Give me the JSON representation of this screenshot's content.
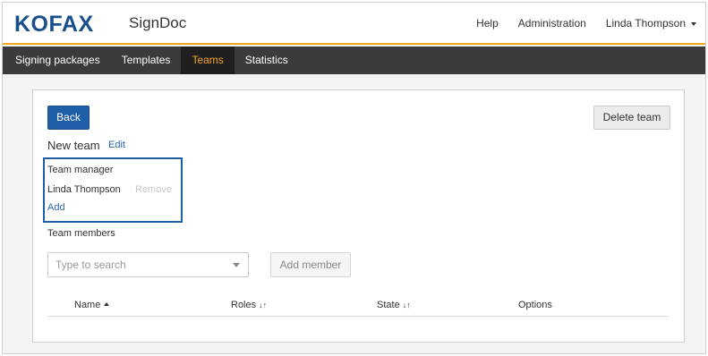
{
  "header": {
    "logo": "KOFAX",
    "product": "SignDoc",
    "links": [
      "Help",
      "Administration"
    ],
    "user": "Linda Thompson"
  },
  "nav": {
    "items": [
      "Signing packages",
      "Templates",
      "Teams",
      "Statistics"
    ],
    "active": "Teams"
  },
  "team": {
    "back_label": "Back",
    "delete_label": "Delete team",
    "name": "New team",
    "edit_label": "Edit",
    "manager_label": "Team manager",
    "manager_name": "Linda Thompson",
    "remove_label": "Remove",
    "add_label": "Add",
    "members_label": "Team members",
    "search_placeholder": "Type to search",
    "add_member_label": "Add member"
  },
  "table": {
    "columns": [
      "Name",
      "Roles",
      "State",
      "Options"
    ],
    "sorted_column": "Name",
    "sort_direction": "ascending"
  },
  "colors": {
    "brand": "#1a4f8b",
    "accent": "#f5a623",
    "primary_button": "#1f5fa8",
    "navbar": "#3b3b3d"
  }
}
